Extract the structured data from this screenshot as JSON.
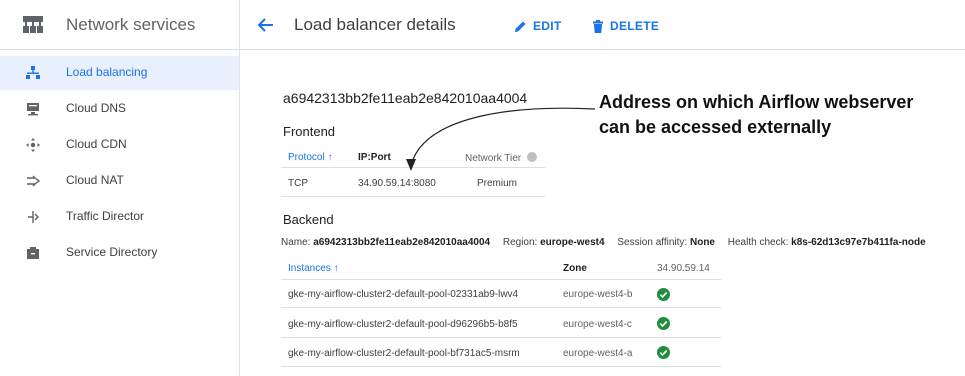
{
  "sidebar": {
    "title": "Network services",
    "items": [
      {
        "label": "Load balancing",
        "icon": "load-balancing-icon",
        "active": true
      },
      {
        "label": "Cloud DNS",
        "icon": "dns-icon",
        "active": false
      },
      {
        "label": "Cloud CDN",
        "icon": "cdn-icon",
        "active": false
      },
      {
        "label": "Cloud NAT",
        "icon": "nat-icon",
        "active": false
      },
      {
        "label": "Traffic Director",
        "icon": "traffic-director-icon",
        "active": false
      },
      {
        "label": "Service Directory",
        "icon": "service-directory-icon",
        "active": false
      }
    ]
  },
  "topbar": {
    "title": "Load balancer details",
    "edit_label": "EDIT",
    "delete_label": "DELETE"
  },
  "details": {
    "name": "a6942313bb2fe11eab2e842010aa4004",
    "frontend": {
      "heading": "Frontend",
      "columns": [
        "Protocol",
        "IP:Port",
        "Network Tier"
      ],
      "rows": [
        {
          "protocol": "TCP",
          "ip_port": "34.90.59.14:8080",
          "tier": "Premium"
        }
      ]
    },
    "backend": {
      "heading": "Backend",
      "name_label": "Name:",
      "name_value": "a6942313bb2fe11eab2e842010aa4004",
      "region_label": "Region:",
      "region_value": "europe-west4",
      "affinity_label": "Session affinity:",
      "affinity_value": "None",
      "health_label": "Health check:",
      "health_value": "k8s-62d13c97e7b411fa-node",
      "columns": [
        "Instances",
        "Zone",
        "34.90.59.14"
      ],
      "rows": [
        {
          "instance": "gke-my-airflow-cluster2-default-pool-02331ab9-lwv4",
          "zone": "europe-west4-b",
          "healthy": true
        },
        {
          "instance": "gke-my-airflow-cluster2-default-pool-d96296b5-b8f5",
          "zone": "europe-west4-c",
          "healthy": true
        },
        {
          "instance": "gke-my-airflow-cluster2-default-pool-bf731ac5-msrm",
          "zone": "europe-west4-a",
          "healthy": true
        }
      ]
    }
  },
  "annotation": {
    "line1": "Address on which Airflow webserver",
    "line2": "can be accessed externally"
  },
  "colors": {
    "accent": "#1a73e8",
    "active_bg": "#e8f0fe",
    "healthy": "#1e8e3e"
  }
}
